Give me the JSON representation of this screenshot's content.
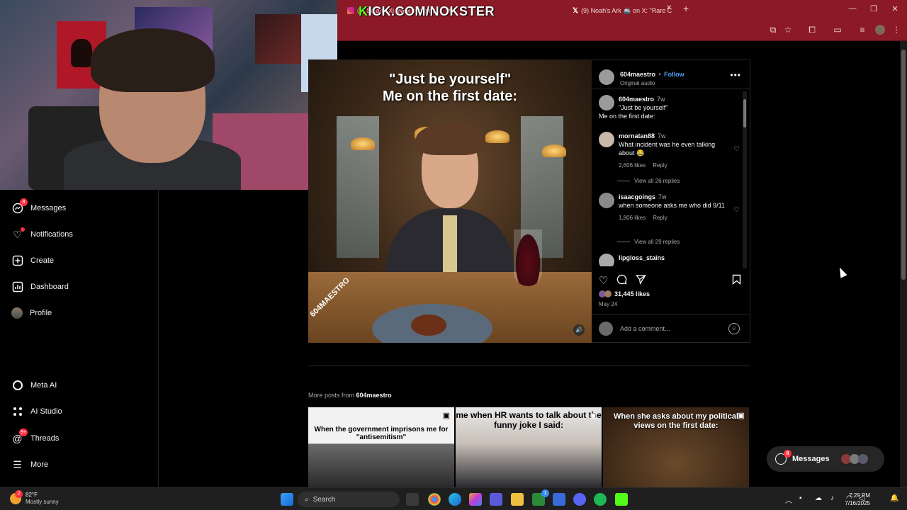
{
  "stream_overlay": {
    "kick_prefix": "K",
    "kick_rest": "ICK.COM/NOKSTER"
  },
  "browser": {
    "tabs": [
      {
        "title": "(9) Solana Xi \"Nick explains t",
        "icon": "instagram-icon"
      },
      {
        "title": "(9) Noah's Ark 🚢 on X: \"Rare C",
        "icon": "x-icon"
      }
    ],
    "new_tab": "+",
    "minimize": "—",
    "restore": "❐",
    "close": "✕"
  },
  "sidebar": {
    "items": [
      {
        "label": "Messages",
        "icon": "messenger-icon",
        "badge": "8"
      },
      {
        "label": "Notifications",
        "icon": "heart-icon",
        "dot": true
      },
      {
        "label": "Create",
        "icon": "plus-square-icon"
      },
      {
        "label": "Dashboard",
        "icon": "dashboard-icon"
      },
      {
        "label": "Profile",
        "icon": "avatar"
      },
      {
        "label": "Meta AI",
        "icon": "meta-ai-icon"
      },
      {
        "label": "AI Studio",
        "icon": "ai-studio-icon"
      },
      {
        "label": "Threads",
        "icon": "threads-icon",
        "badge": "9+"
      },
      {
        "label": "More",
        "icon": "menu-icon"
      }
    ]
  },
  "post": {
    "caption_overlay": "\"Just be yourself\"\nMe on the first date:",
    "watermark": "604MAESTRO",
    "author": "604maestro",
    "follow": "Follow",
    "separator": "•",
    "audio": "Original audio",
    "caption": {
      "user": "604maestro",
      "time": "7w",
      "line1": "\"Just be yourself\"",
      "line2": "Me on the first date:"
    },
    "comments": [
      {
        "user": "mornatan88",
        "time": "7w",
        "text": "What incident was he even talking about 😂",
        "likes": "2,606 likes",
        "reply": "Reply",
        "replies": "View all 26 replies"
      },
      {
        "user": "isaacgoings",
        "time": "7w",
        "text": "when someone asks me who did 9/11",
        "likes": "1,806 likes",
        "reply": "Reply",
        "replies": "View all 29 replies"
      },
      {
        "user": "lipgloss_stains",
        "time": "",
        "text": ""
      }
    ],
    "like_count": "31,445 likes",
    "date": "May 24",
    "add_comment_placeholder": "Add a comment..."
  },
  "more_posts": {
    "prefix": "More posts from ",
    "user": "604maestro",
    "thumbnails": [
      {
        "caption": "When the government imprisons me for \"antisemitism\""
      },
      {
        "caption": "me when HR wants to talk about the funny joke I said:"
      },
      {
        "caption": "When she asks about my political views on the first date:"
      }
    ]
  },
  "messages_pill": {
    "label": "Messages",
    "badge": "8"
  },
  "taskbar": {
    "weather_badge": "2",
    "temp": "82°F",
    "condition": "Mostly sunny",
    "search": "Search",
    "time": "7:29 PM",
    "date": "7/16/2025",
    "store_badge": "1"
  },
  "colors": {
    "browser_frame": "#8b1a26",
    "link_blue": "#4a9ff5",
    "notif_red": "#ff3040",
    "kick_green": "#53fc18"
  }
}
